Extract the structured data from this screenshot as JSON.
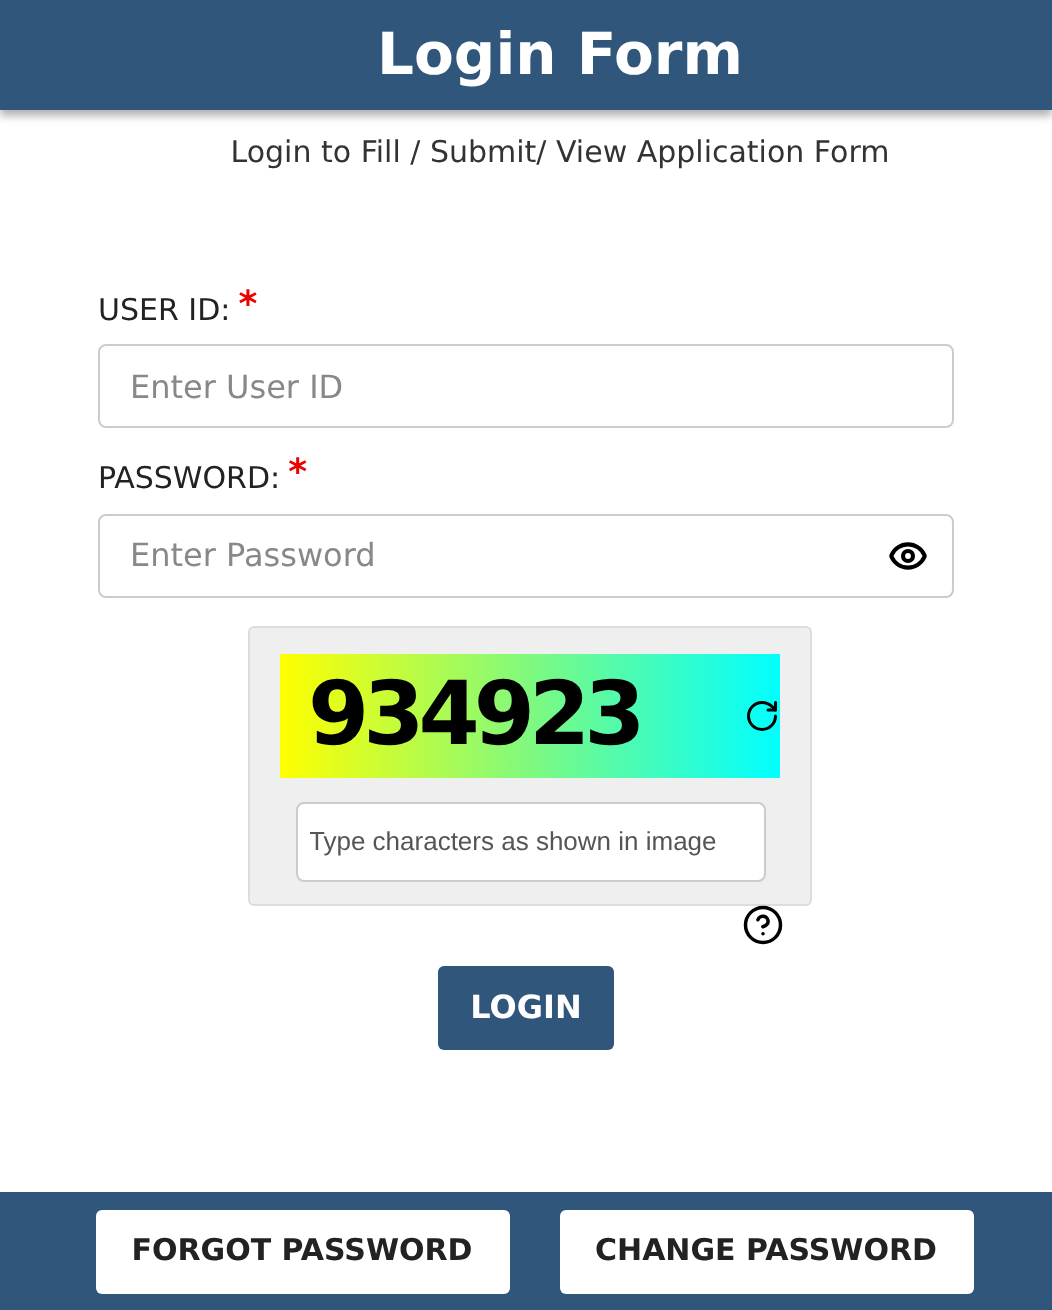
{
  "header": {
    "title": "Login Form"
  },
  "subtitle": "Login to Fill / Submit/ View Application Form",
  "fields": [
    {
      "label": "USER ID:",
      "required_mark": "*",
      "placeholder": "Enter User ID",
      "kind": "text"
    },
    {
      "label": "PASSWORD:",
      "required_mark": "*",
      "placeholder": "Enter Password",
      "kind": "password"
    }
  ],
  "captcha": {
    "code": "934923",
    "placeholder": "Type characters as shown in image"
  },
  "login_button": "LOGIN",
  "footer_buttons": [
    "FORGOT PASSWORD",
    "CHANGE PASSWORD"
  ]
}
